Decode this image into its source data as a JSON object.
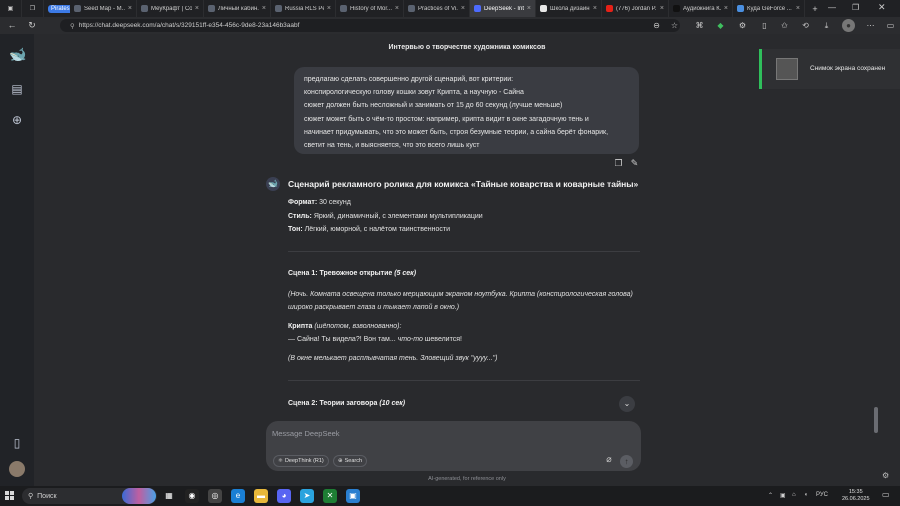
{
  "browser": {
    "tabs": [
      {
        "label": "Pirates",
        "type": "group"
      },
      {
        "label": "Seed Map - M..."
      },
      {
        "label": "МеуКрафт | Со..."
      },
      {
        "label": "Личный кабин..."
      },
      {
        "label": "Russia RLS Per..."
      },
      {
        "label": "History of Mor..."
      },
      {
        "label": "Practices of Vi..."
      },
      {
        "label": "DeepSeek - Int...",
        "active": true
      },
      {
        "label": "Школа дизайн..."
      },
      {
        "label": "(776) Jordan P..."
      },
      {
        "label": "Аудиокнига К..."
      },
      {
        "label": "Куда GeForce ..."
      }
    ],
    "url": "https://chat.deepseek.com/a/chat/s/329151ff-e354-456c-9de8-23a146b3aabf"
  },
  "chat": {
    "title": "Интервью о творчестве художника комиксов",
    "user_message": [
      "предлагаю сделать совершенно другой сценарий, вот критерии:",
      "конспирологическую голову кошки зовут Крипта, а научную - Сайна",
      "сюжет должен быть несложный и занимать от 15 до 60 секунд (лучше меньше)",
      "сюжет может быть о чём-то простом: например, крипта видит в окне загадочную тень и",
      "начинает придумывать, что это может быть, строя безумные теории, а сайна берёт фонарик,",
      "светит на тень, и выясняется, что это всего лишь куст"
    ],
    "ai": {
      "heading": "Сценарий рекламного ролика для комикса «Тайные коварства и коварные тайны»",
      "format_label": "Формат:",
      "format_value": " 30 секунд",
      "style_label": "Стиль:",
      "style_value": " Яркий, динамичный, с элементами мультипликации",
      "tone_label": "Тон:",
      "tone_value": " Лёгкий, юморной, с налётом таинственности",
      "scene1_title": "Сцена 1: Тревожное открытие",
      "scene1_time": " (5 сек)",
      "scene1_desc": "(Ночь. Комната освещена только мерцающим экраном ноутбука. Крипта (конспирологическая голова) широко раскрывает глаза и тыкает лапой в окно.)",
      "scene1_speaker": "Крипта",
      "scene1_manner": " (шёпотом, взволнованно):",
      "scene1_line_a": "— Сайна! Ты видела?! Вон там... ",
      "scene1_line_em": "что-то",
      "scene1_line_b": " шевелится!",
      "scene1_note": "(В окне мелькает расплывчатая тень. Зловещий звук \"уууу...\")",
      "scene2_title": "Сцена 2: Теории заговора",
      "scene2_time": " (10 сек)"
    },
    "composer": {
      "placeholder": "Message DeepSeek",
      "deepthink_label": "DeepThink (R1)",
      "search_label": "Search"
    },
    "disclaimer": "AI-generated, for reference only"
  },
  "notification": {
    "text": "Снимок экрана сохранен"
  },
  "taskbar": {
    "search_label": "Поиск",
    "language": "РУС",
    "time": "15:35",
    "date": "26.06.2025"
  },
  "colors": {
    "accent": "#4d6bfe",
    "toast_bar": "#2fbf5b"
  }
}
